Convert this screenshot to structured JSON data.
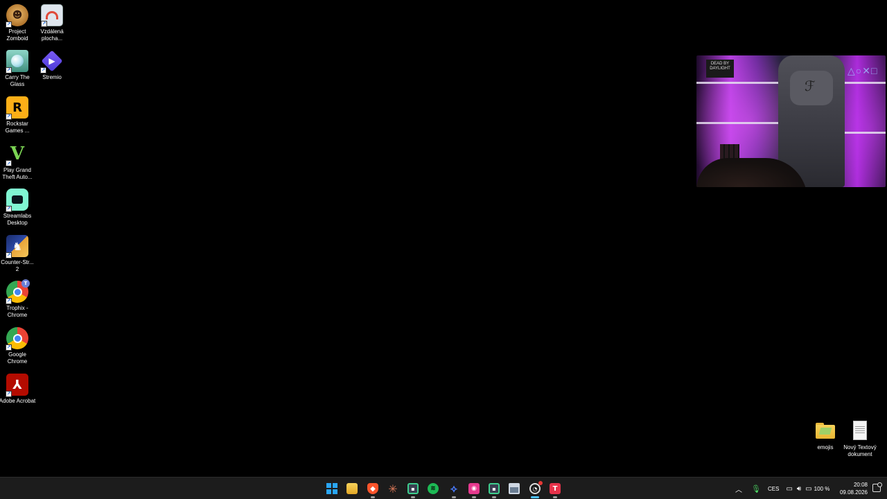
{
  "desktop_icons": [
    {
      "label": "Project Zomboid",
      "icon": "zombie-face-icon"
    },
    {
      "label": "Vzdálená plocha...",
      "icon": "remote-desktop-icon"
    },
    {
      "label": "Carry The Glass",
      "icon": "glass-ball-icon"
    },
    {
      "label": "Stremio",
      "icon": "play-diamond-icon"
    },
    {
      "label": "Rockstar Games ...",
      "icon": "rockstar-logo-icon"
    },
    {
      "label": "Play Grand Theft Auto...",
      "icon": "gta-v-icon"
    },
    {
      "label": "Streamlabs Desktop",
      "icon": "streamlabs-icon"
    },
    {
      "label": "Counter-Str... 2",
      "icon": "counter-strike-icon"
    },
    {
      "label": "Trophix - Chrome",
      "icon": "chrome-profile-icon"
    },
    {
      "label": "Google Chrome",
      "icon": "chrome-icon"
    },
    {
      "label": "Adobe Acrobat",
      "icon": "acrobat-icon"
    },
    {
      "label": "emojis",
      "icon": "folder-icon"
    },
    {
      "label": "Nový Textový dokument",
      "icon": "text-document-icon"
    }
  ],
  "webcam": {
    "sign_text": "DEAD BY DAYLIGHT",
    "playstation_symbols": "△○✕□"
  },
  "taskbar": {
    "apps": [
      {
        "name": "start",
        "icon": "windows-start-icon",
        "color": "#2aa6f5"
      },
      {
        "name": "file-explorer",
        "icon": "folder-icon",
        "color": "#f5c542"
      },
      {
        "name": "brave",
        "icon": "brave-lion-icon",
        "color": "#fb542b"
      },
      {
        "name": "claude",
        "icon": "sparkle-icon",
        "color": "#d97757"
      },
      {
        "name": "app-teal",
        "icon": "chat-icon",
        "color": "#3ecf8e"
      },
      {
        "name": "spotify",
        "icon": "spotify-icon",
        "color": "#1db954"
      },
      {
        "name": "app-blue",
        "icon": "cursor-icon",
        "color": "#4a7cff"
      },
      {
        "name": "app-pink",
        "icon": "record-icon",
        "color": "#e5398e"
      },
      {
        "name": "app-green",
        "icon": "chat-icon",
        "color": "#3ecf8e"
      },
      {
        "name": "app-window",
        "icon": "window-icon",
        "color": "#cfd8e3"
      },
      {
        "name": "steelseries",
        "icon": "gauge-icon",
        "color": "#dddddd"
      },
      {
        "name": "trophix",
        "icon": "trophix-icon",
        "color": "#e7324a"
      }
    ],
    "tray": {
      "language": "CES",
      "battery": "100 %",
      "time": "20:08",
      "date": "09.08.2026"
    }
  },
  "colors": {
    "taskbar_bg": "#1c1c1c",
    "accent": "#4cc2ff"
  }
}
